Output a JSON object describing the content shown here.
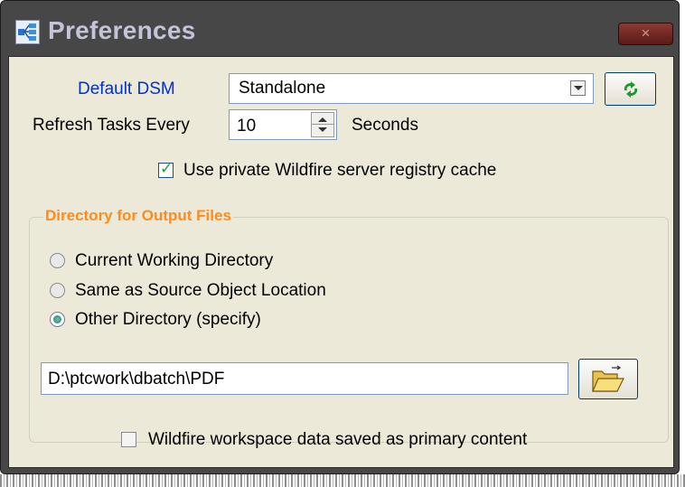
{
  "window": {
    "title": "Preferences",
    "icon": "preferences-app-icon",
    "close_label": "×"
  },
  "dsm": {
    "label": "Default DSM",
    "value": "Standalone",
    "refresh_icon": "refresh-arrows-icon"
  },
  "refresh": {
    "label": "Refresh Tasks Every",
    "value": "10",
    "unit": "Seconds"
  },
  "cache": {
    "label": "Use private Wildfire server registry cache",
    "checked": true
  },
  "output": {
    "group_title": "Directory for Output Files",
    "options": [
      {
        "label": "Current Working Directory",
        "selected": false
      },
      {
        "label": "Same as Source Object Location",
        "selected": false
      },
      {
        "label": "Other Directory (specify)",
        "selected": true
      }
    ],
    "path": "D:\\ptcwork\\dbatch\\PDF",
    "browse_icon": "open-folder-icon"
  },
  "workspace": {
    "label": "Wildfire workspace data saved as primary content",
    "checked": false
  },
  "colors": {
    "title_bar": "#474747",
    "dialog_bg": "#ece9d8",
    "group_title": "#ff8c1a",
    "link_label": "#0033cc"
  }
}
